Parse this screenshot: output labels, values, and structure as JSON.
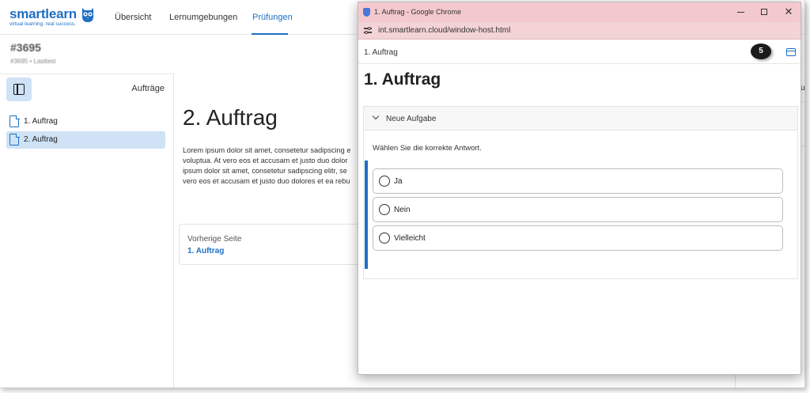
{
  "app": {
    "logo": {
      "name": "smartlearn",
      "tagline": "virtual learning. real success."
    },
    "nav": [
      "Übersicht",
      "Lernumgebungen",
      "Prüfungen"
    ],
    "header": {
      "id": "#3695",
      "sub": "#3695 • Lasttest"
    },
    "sidebar": {
      "title": "Aufträge",
      "items": [
        {
          "label": "1. Auftrag"
        },
        {
          "label": "2. Auftrag"
        }
      ]
    },
    "main": {
      "title": "2. Auftrag",
      "body": [
        "Lorem ipsum dolor sit amet, consetetur sadipscing e",
        "voluptua. At vero eos et accusam et justo duo dolor",
        "ipsum dolor sit amet, consetetur sadipscing elitr, se",
        "vero eos et accusam et justo duo dolores et ea rebu"
      ],
      "prev": {
        "label": "Vorherige Seite",
        "link": "1. Auftrag"
      }
    },
    "right_fragment": "u"
  },
  "popup": {
    "window_title": "1. Auftrag - Google Chrome",
    "url": "int.smartlearn.cloud/window-host.html",
    "head_title": "1. Auftrag",
    "step_badge": "5",
    "title": "1. Auftrag",
    "section": {
      "title": "Neue Aufgabe",
      "question": "Wählen Sie die korrekte Antwort.",
      "options": [
        "Ja",
        "Nein",
        "Vielleicht"
      ]
    }
  },
  "colors": {
    "accent": "#1e6fc4",
    "titlebar": "#f3c9cd",
    "selected": "#cfe2f6"
  }
}
